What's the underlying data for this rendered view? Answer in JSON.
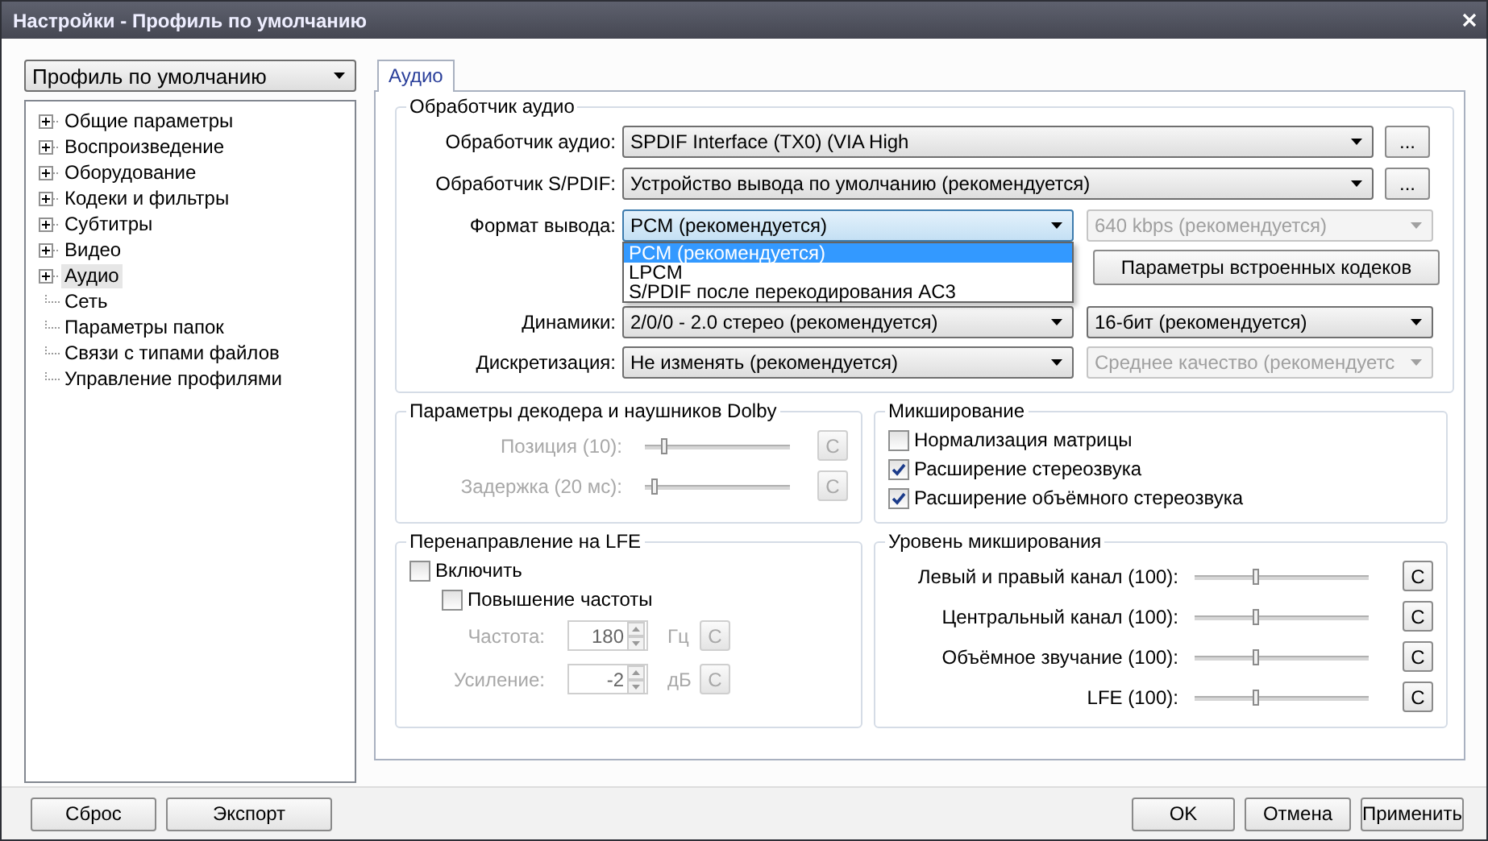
{
  "window": {
    "title": "Настройки - Профиль по умолчанию"
  },
  "profile_select": {
    "value": "Профиль по умолчанию"
  },
  "tree": {
    "items": [
      {
        "label": "Общие параметры",
        "expanded": false,
        "selected": false
      },
      {
        "label": "Воспроизведение",
        "expanded": false,
        "selected": false
      },
      {
        "label": "Оборудование",
        "expanded": false,
        "selected": false
      },
      {
        "label": "Кодеки и фильтры",
        "expanded": false,
        "selected": false
      },
      {
        "label": "Субтитры",
        "expanded": false,
        "selected": false
      },
      {
        "label": "Видео",
        "expanded": false,
        "selected": false
      },
      {
        "label": "Аудио",
        "expanded": false,
        "selected": true
      },
      {
        "label": "Сеть",
        "selected": false
      },
      {
        "label": "Параметры папок",
        "selected": false
      },
      {
        "label": "Связи с типами файлов",
        "selected": false
      },
      {
        "label": "Управление профилями",
        "selected": false
      }
    ]
  },
  "tabs": [
    {
      "label": "Аудио",
      "selected": true
    }
  ],
  "audio_handler": {
    "title": "Обработчик аудио",
    "device": {
      "label": "Обработчик аудио:",
      "value": "SPDIF Interface (TX0) (VIA High",
      "button": "..."
    },
    "spdif": {
      "label": "Обработчик S/PDIF:",
      "value": "Устройство вывода по умолчанию (рекомендуется)",
      "button": "..."
    },
    "format": {
      "label": "Формат вывода:",
      "value": "PCM (рекомендуется)",
      "open": true,
      "options": [
        {
          "label": "PCM (рекомендуется)",
          "selected": true
        },
        {
          "label": "LPCM",
          "selected": false
        },
        {
          "label": "S/PDIF после перекодирования AC3",
          "selected": false
        }
      ],
      "bitrate": {
        "value": "640 kbps (рекомендуется)",
        "disabled": true
      }
    },
    "codec_button": "Параметры встроенных кодеков",
    "speakers": {
      "label": "Динамики:",
      "value": "2/0/0 - 2.0 стерео (рекомендуется)",
      "side": {
        "value": "16-бит (рекомендуется)",
        "disabled": false
      }
    },
    "resampling": {
      "label": "Дискретизация:",
      "value": "Не изменять (рекомендуется)",
      "side": {
        "value": "Среднее качество (рекомендуетс",
        "disabled": true
      }
    }
  },
  "dolby": {
    "title": "Параметры декодера и наушников Dolby",
    "sliders": [
      {
        "label": "Позиция (10):",
        "level": 0.13,
        "reset": "C",
        "disabled": true
      },
      {
        "label": "Задержка (20 мс):",
        "level": 0.07,
        "reset": "C",
        "disabled": true
      }
    ]
  },
  "mixing": {
    "title": "Микширование",
    "options": [
      {
        "label": "Нормализация матрицы",
        "checked": false
      },
      {
        "label": "Расширение стереозвука",
        "checked": true
      },
      {
        "label": "Расширение объёмного стереозвука",
        "checked": true
      }
    ]
  },
  "lfe": {
    "title": "Перенаправление на LFE",
    "enable": {
      "label": "Включить",
      "checked": false
    },
    "boost": {
      "label": "Повышение частоты",
      "checked": false
    },
    "fields": [
      {
        "label": "Частота:",
        "value": "180",
        "unit": "Гц",
        "reset": "C",
        "disabled": true
      },
      {
        "label": "Усиление:",
        "value": "-2",
        "unit": "дБ",
        "reset": "C",
        "disabled": true
      }
    ]
  },
  "mix_levels": {
    "title": "Уровень микширования",
    "sliders": [
      {
        "label": "Левый и правый канал (100):",
        "level": 0.35,
        "reset": "C",
        "disabled": false
      },
      {
        "label": "Центральный канал (100):",
        "level": 0.35,
        "reset": "C",
        "disabled": false
      },
      {
        "label": "Объёмное звучание (100):",
        "level": 0.35,
        "reset": "C",
        "disabled": false
      },
      {
        "label": "LFE (100):",
        "level": 0.35,
        "reset": "C",
        "disabled": false
      }
    ]
  },
  "footer": {
    "left_buttons": [
      "Сброс",
      "Экспорт"
    ],
    "right_buttons": [
      "OK",
      "Отмена",
      "Применить"
    ]
  }
}
